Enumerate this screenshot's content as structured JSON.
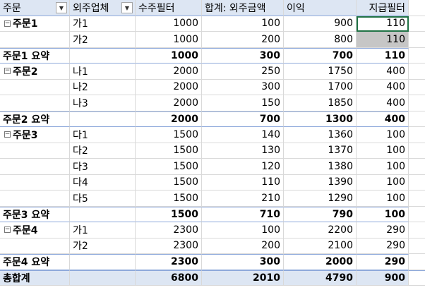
{
  "header": {
    "col1": "주문",
    "col2": "외주업체",
    "col3": "수주필터",
    "col4": "합계: 외주금액",
    "col5": "이익",
    "col6": "지급필터",
    "dropdown_icon": "▼"
  },
  "rows": [
    {
      "type": "item",
      "group": "주문1",
      "vendor": "가1",
      "order": "1000",
      "cost": "100",
      "profit": "900",
      "pay": "110"
    },
    {
      "type": "item",
      "group": "",
      "vendor": "가2",
      "order": "1000",
      "cost": "200",
      "profit": "800",
      "pay": "110"
    },
    {
      "type": "subtotal",
      "label": "주문1 요약",
      "order": "1000",
      "cost": "300",
      "profit": "700",
      "pay": "110"
    },
    {
      "type": "item",
      "group": "주문2",
      "vendor": "나1",
      "order": "2000",
      "cost": "250",
      "profit": "1750",
      "pay": "400"
    },
    {
      "type": "item",
      "group": "",
      "vendor": "나2",
      "order": "2000",
      "cost": "300",
      "profit": "1700",
      "pay": "400"
    },
    {
      "type": "item",
      "group": "",
      "vendor": "나3",
      "order": "2000",
      "cost": "150",
      "profit": "1850",
      "pay": "400"
    },
    {
      "type": "subtotal",
      "label": "주문2 요약",
      "order": "2000",
      "cost": "700",
      "profit": "1300",
      "pay": "400"
    },
    {
      "type": "item",
      "group": "주문3",
      "vendor": "다1",
      "order": "1500",
      "cost": "140",
      "profit": "1360",
      "pay": "100"
    },
    {
      "type": "item",
      "group": "",
      "vendor": "다2",
      "order": "1500",
      "cost": "130",
      "profit": "1370",
      "pay": "100"
    },
    {
      "type": "item",
      "group": "",
      "vendor": "다3",
      "order": "1500",
      "cost": "120",
      "profit": "1380",
      "pay": "100"
    },
    {
      "type": "item",
      "group": "",
      "vendor": "다4",
      "order": "1500",
      "cost": "110",
      "profit": "1390",
      "pay": "100"
    },
    {
      "type": "item",
      "group": "",
      "vendor": "다5",
      "order": "1500",
      "cost": "210",
      "profit": "1290",
      "pay": "100"
    },
    {
      "type": "subtotal",
      "label": "주문3 요약",
      "order": "1500",
      "cost": "710",
      "profit": "790",
      "pay": "100"
    },
    {
      "type": "item",
      "group": "주문4",
      "vendor": "가1",
      "order": "2300",
      "cost": "100",
      "profit": "2200",
      "pay": "290"
    },
    {
      "type": "item",
      "group": "",
      "vendor": "가2",
      "order": "2300",
      "cost": "200",
      "profit": "2100",
      "pay": "290"
    },
    {
      "type": "subtotal",
      "label": "주문4 요약",
      "order": "2300",
      "cost": "300",
      "profit": "2000",
      "pay": "290"
    }
  ],
  "total": {
    "label": "총합계",
    "order": "6800",
    "cost": "2010",
    "profit": "4790",
    "pay": "900"
  },
  "collapse_symbol": "−"
}
